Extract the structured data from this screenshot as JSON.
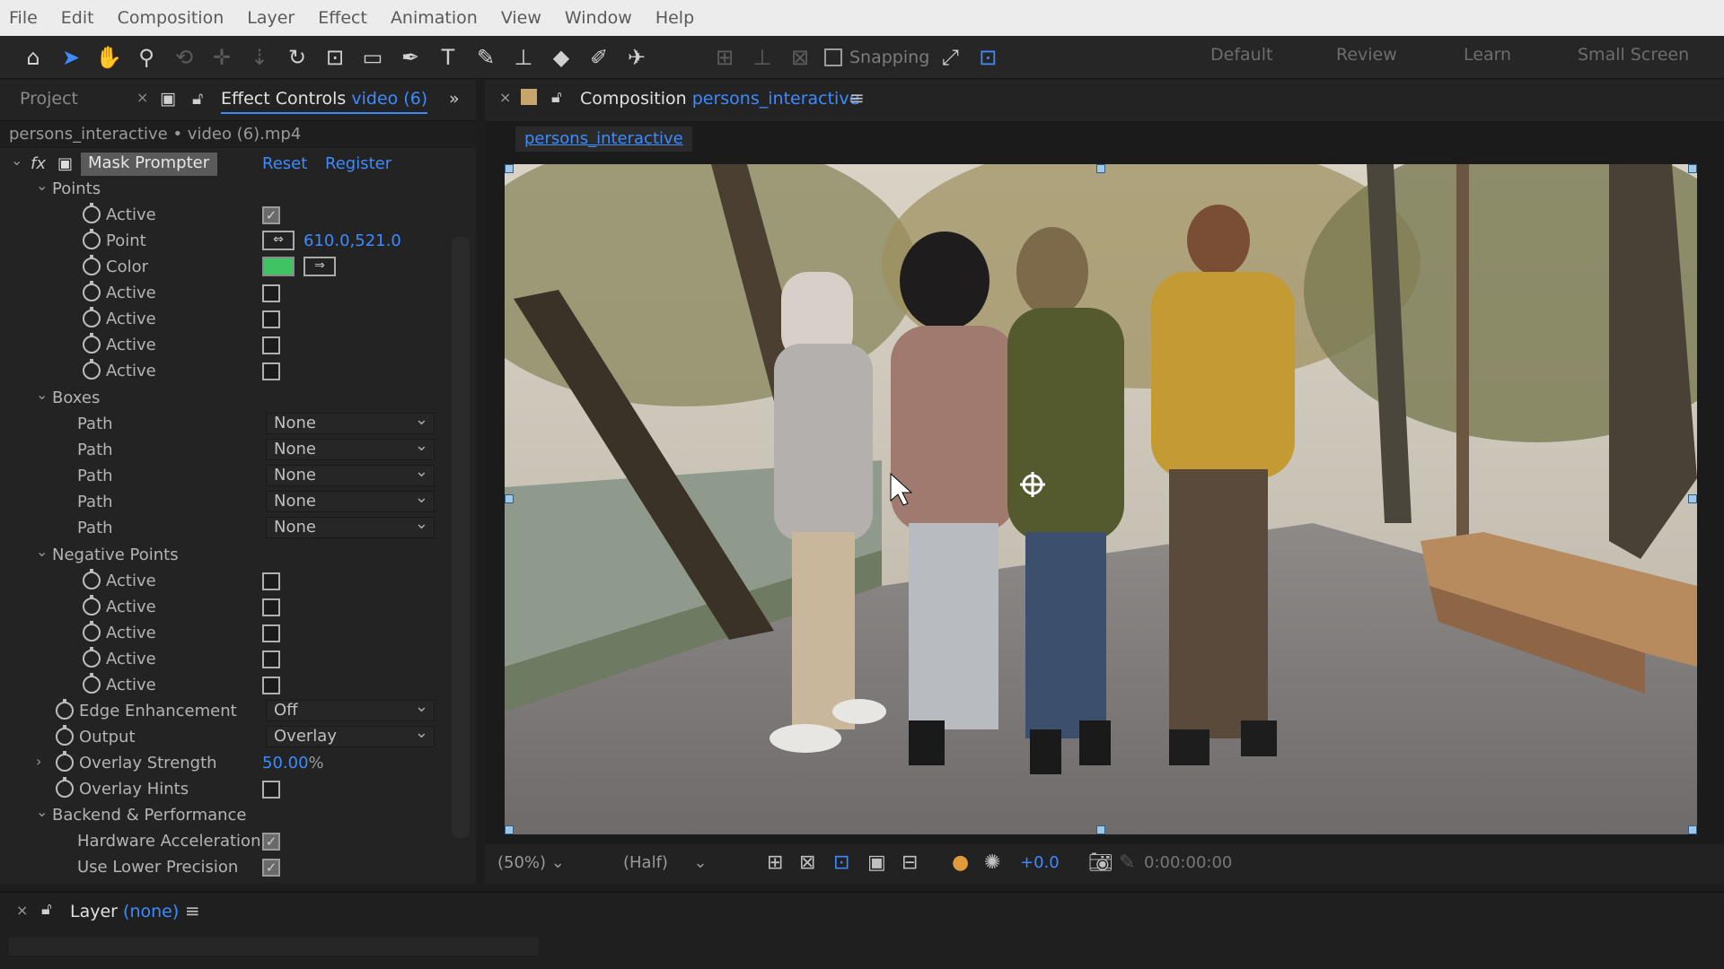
{
  "menu": [
    "File",
    "Edit",
    "Composition",
    "Layer",
    "Effect",
    "Animation",
    "View",
    "Window",
    "Help"
  ],
  "toolbar": {
    "tools": [
      "home-icon",
      "selection-tool-icon",
      "hand-tool-icon",
      "zoom-tool-icon",
      "orbit-camera-icon",
      "pan-behind-icon",
      "track-z-icon",
      "rotate-tool-icon",
      "anchor-point-icon",
      "rectangle-tool-icon",
      "pen-tool-icon",
      "type-tool-icon",
      "brush-tool-icon",
      "clone-stamp-icon",
      "eraser-tool-icon",
      "roto-brush-icon",
      "puppet-pin-icon"
    ],
    "snapping_label": "Snapping",
    "workspaces": [
      "Default",
      "Review",
      "Learn",
      "Small Screen"
    ]
  },
  "left_panel": {
    "tab_project": "Project",
    "tab_effect_controls": "Effect Controls",
    "tab_effect_controls_layer": "video (6)",
    "file_line": "persons_interactive • video (6).mp4",
    "effect": {
      "fx_label": "fx",
      "name": "Mask Prompter",
      "reset": "Reset",
      "register": "Register"
    },
    "points_group": "Points",
    "active_label": "Active",
    "point_label": "Point",
    "point_value": "610.0,521.0",
    "color_label": "Color",
    "boxes_group": "Boxes",
    "path_label": "Path",
    "path_value": "None",
    "negative_points_group": "Negative Points",
    "edge_enhancement_label": "Edge Enhancement",
    "edge_enhancement_value": "Off",
    "output_label": "Output",
    "output_value": "Overlay",
    "overlay_strength_label": "Overlay Strength",
    "overlay_strength_value": "50.00",
    "overlay_strength_unit": "%",
    "overlay_hints_label": "Overlay Hints",
    "backend_group": "Backend & Performance",
    "hardware_accel_label": "Hardware Acceleration",
    "lower_precision_label": "Use Lower Precision"
  },
  "comp_panel": {
    "tab_label": "Composition",
    "tab_comp_name": "persons_interactive",
    "subtab": "persons_interactive",
    "zoom": "(50%)",
    "resolution": "(Half)",
    "exposure": "+0.0",
    "timecode": "0:00:00:00"
  },
  "layer_panel": {
    "tab_label": "Layer",
    "tab_value": "(none)"
  },
  "colors": {
    "accent": "#3d8bff",
    "panel_bg": "#232323",
    "menubar_bg": "#ececec",
    "color_swatch": "#3fc463"
  }
}
